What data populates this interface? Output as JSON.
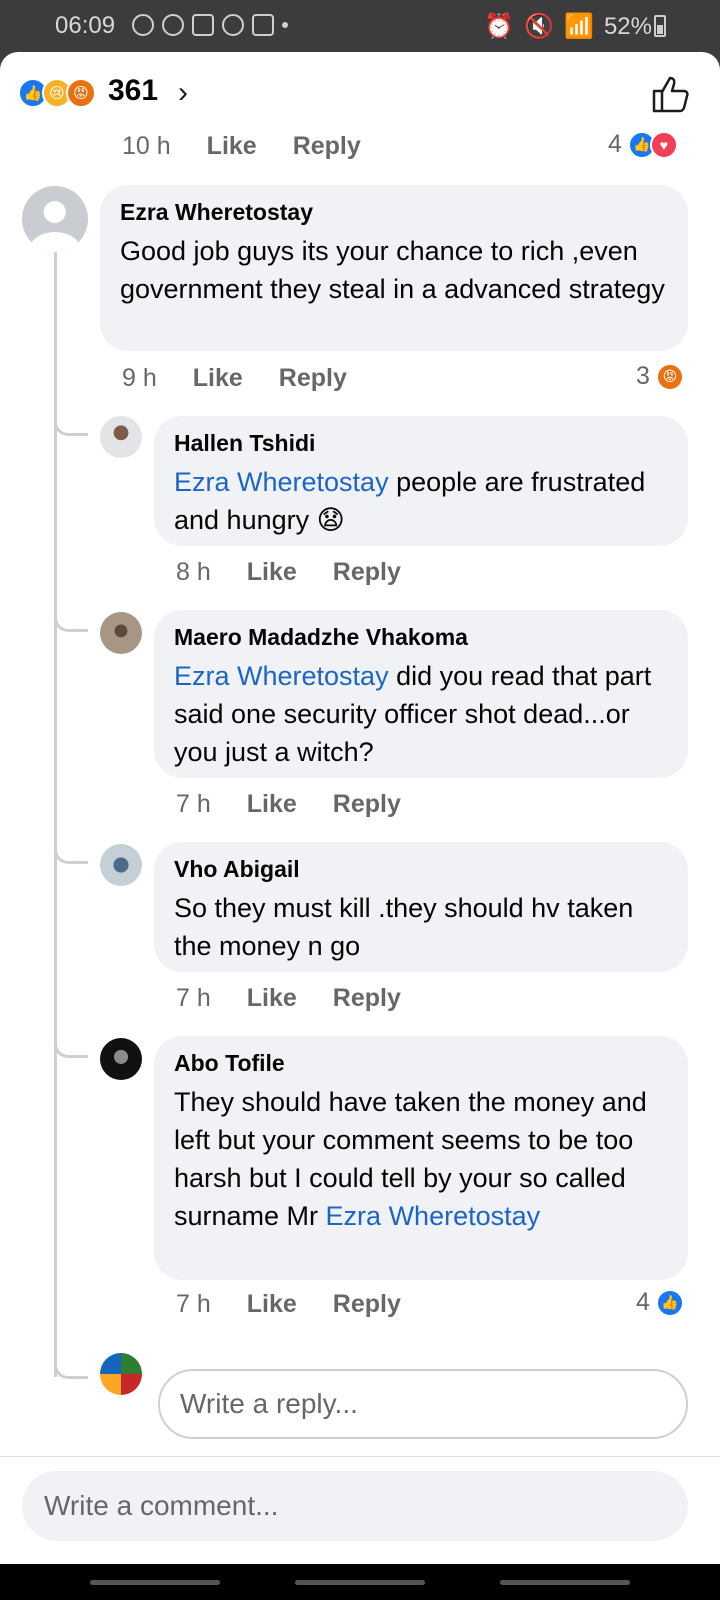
{
  "status_bar": {
    "time": "06:09",
    "battery": "52%",
    "icons": [
      "sync-icon",
      "sync-icon",
      "s-app-icon",
      "person-icon",
      "mail-icon",
      "dot-icon",
      "alarm-icon",
      "mute-icon",
      "wifi-icon",
      "signal-icon",
      "battery-icon"
    ]
  },
  "reactions_bar": {
    "count": "361",
    "icons": [
      "like-reaction-icon",
      "sad-reaction-icon",
      "angry-reaction-icon"
    ]
  },
  "top_comment_meta": {
    "time": "10 h",
    "like": "Like",
    "reply": "Reply",
    "reaction_count": "4"
  },
  "comments": [
    {
      "name": "Ezra Wheretostay",
      "text": "Good  job guys its your chance to rich ,even government they steal in a advanced strategy",
      "time": "9 h",
      "like": "Like",
      "reply": "Reply",
      "reaction_count": "3"
    }
  ],
  "replies": [
    {
      "name": "Hallen Tshidi",
      "mention": "Ezra Wheretostay",
      "text": " people are frustrated and hungry 😧",
      "time": "8 h",
      "like": "Like",
      "reply": "Reply"
    },
    {
      "name": "Maero Madadzhe Vhakoma",
      "mention": "Ezra Wheretostay",
      "text": " did you read that part said one security officer shot dead...or you just a witch?",
      "time": "7 h",
      "like": "Like",
      "reply": "Reply"
    },
    {
      "name": "Vho Abigail",
      "text": "So they must kill .they should hv taken the money n go",
      "time": "7 h",
      "like": "Like",
      "reply": "Reply"
    },
    {
      "name": "Abo Tofile",
      "text": "They should have taken the money and left but your comment seems to be too harsh but I could tell by your so called surname Mr ",
      "mention": "Ezra Wheretostay",
      "time": "7 h",
      "like": "Like",
      "reply": "Reply",
      "reaction_count": "4"
    }
  ],
  "reply_input": {
    "placeholder": "Write a reply..."
  },
  "composer": {
    "placeholder": "Write a comment..."
  },
  "colors": {
    "facebook_blue": "#1877f2",
    "mention": "#1b65c7",
    "bubble": "#f0f2f5",
    "meta_gray": "#65676b"
  }
}
